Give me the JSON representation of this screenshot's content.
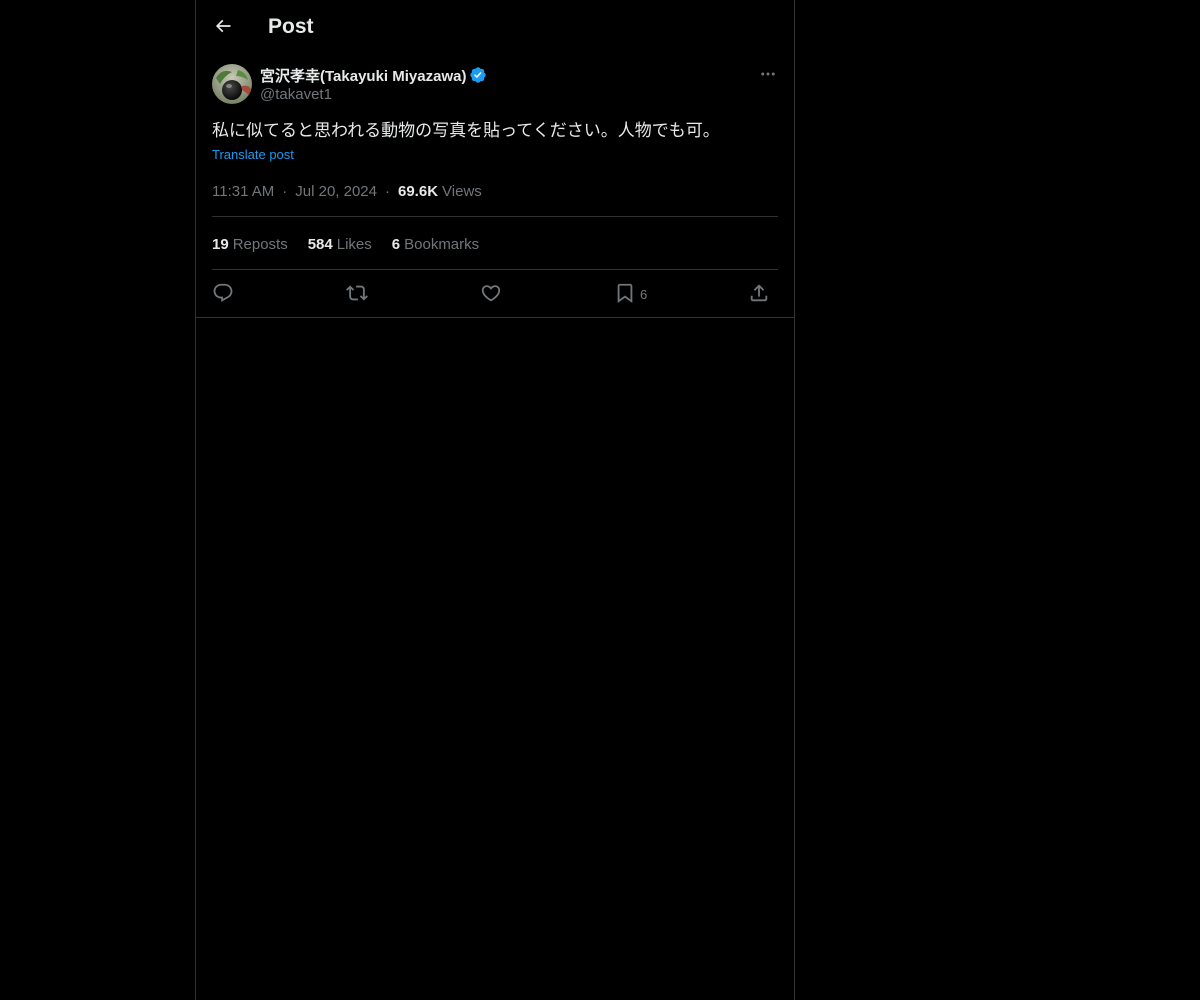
{
  "header": {
    "title": "Post",
    "back_icon": "arrow-left-icon"
  },
  "post": {
    "author": {
      "display_name": "宮沢孝幸(Takayuki Miyazawa)",
      "handle": "@takavet1",
      "verified": true,
      "verified_color": "#1d9bf0"
    },
    "text": "私に似てると思われる動物の写真を貼ってください。人物でも可。",
    "translate_label": "Translate post",
    "time": "11:31 AM",
    "date": "Jul 20, 2024",
    "views_count": "69.6K",
    "views_label": "Views",
    "separator": "·"
  },
  "stats": {
    "reposts_count": "19",
    "reposts_label": "Reposts",
    "likes_count": "584",
    "likes_label": "Likes",
    "bookmarks_count": "6",
    "bookmarks_label": "Bookmarks"
  },
  "actions": {
    "reply_icon": "reply-icon",
    "repost_icon": "repost-icon",
    "like_icon": "heart-icon",
    "bookmark_icon": "bookmark-icon",
    "bookmark_count": "6",
    "share_icon": "share-icon"
  },
  "colors": {
    "background": "#000000",
    "text_primary": "#e7e9ea",
    "text_secondary": "#71767b",
    "accent": "#1d9bf0",
    "border": "#2f3336"
  }
}
